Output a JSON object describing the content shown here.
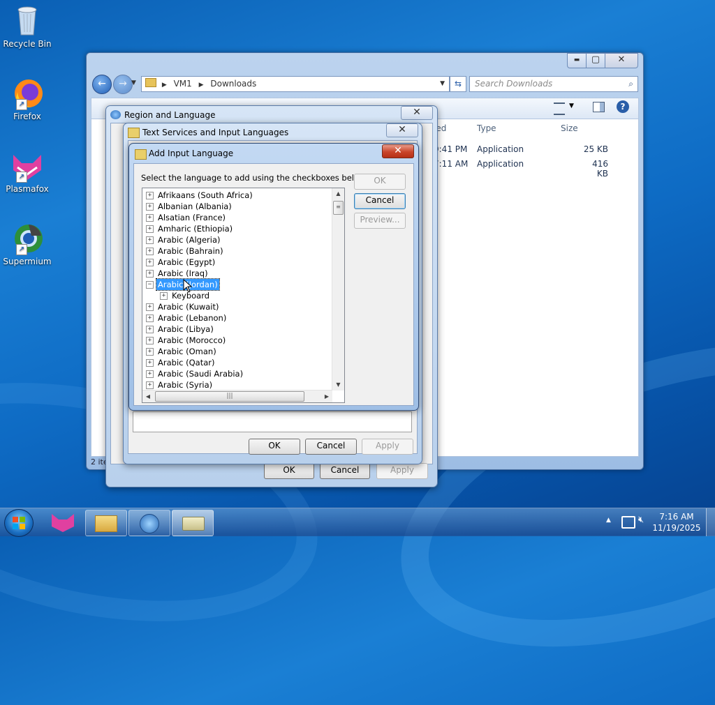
{
  "desktop": {
    "icons": [
      {
        "label": "Recycle Bin"
      },
      {
        "label": "Firefox"
      },
      {
        "label": "Plasmafox"
      },
      {
        "label": "Supermium"
      }
    ]
  },
  "explorer": {
    "caption_buttons": {
      "minimize": "▬",
      "maximize": "▢",
      "close": "✕"
    },
    "breadcrumb": [
      "VM1",
      "Downloads"
    ],
    "search_placeholder": "Search Downloads",
    "columns": [
      "ied",
      "Type",
      "Size"
    ],
    "files": [
      {
        "modified": "9:41 PM",
        "type": "Application",
        "size": "25 KB"
      },
      {
        "modified": "7:11 AM",
        "type": "Application",
        "size": "416 KB"
      }
    ],
    "status": "2 ite"
  },
  "region_dialog": {
    "title": "Region and Language",
    "buttons": {
      "ok": "OK",
      "cancel": "Cancel",
      "apply": "Apply"
    }
  },
  "text_services_dialog": {
    "title": "Text Services and Input Languages",
    "buttons": {
      "ok": "OK",
      "cancel": "Cancel",
      "apply": "Apply"
    }
  },
  "add_language_dialog": {
    "title": "Add Input Language",
    "instruction": "Select the language to add using the checkboxes below.",
    "buttons": {
      "ok": "OK",
      "cancel": "Cancel",
      "preview": "Preview..."
    },
    "languages": [
      {
        "label": "Afrikaans (South Africa)",
        "expanded": false
      },
      {
        "label": "Albanian (Albania)",
        "expanded": false
      },
      {
        "label": "Alsatian (France)",
        "expanded": false
      },
      {
        "label": "Amharic (Ethiopia)",
        "expanded": false
      },
      {
        "label": "Arabic (Algeria)",
        "expanded": false
      },
      {
        "label": "Arabic (Bahrain)",
        "expanded": false
      },
      {
        "label": "Arabic (Egypt)",
        "expanded": false
      },
      {
        "label": "Arabic (Iraq)",
        "expanded": false
      },
      {
        "label": "Arabic (Jordan)",
        "expanded": true,
        "selected": true
      },
      {
        "label": "Keyboard",
        "child": true
      },
      {
        "label": "Arabic (Kuwait)",
        "expanded": false
      },
      {
        "label": "Arabic (Lebanon)",
        "expanded": false
      },
      {
        "label": "Arabic (Libya)",
        "expanded": false
      },
      {
        "label": "Arabic (Morocco)",
        "expanded": false
      },
      {
        "label": "Arabic (Oman)",
        "expanded": false
      },
      {
        "label": "Arabic (Qatar)",
        "expanded": false
      },
      {
        "label": "Arabic (Saudi Arabia)",
        "expanded": false
      },
      {
        "label": "Arabic (Syria)",
        "expanded": false
      }
    ],
    "hscroll_grip": "|||"
  },
  "taskbar": {
    "clock_time": "7:16 AM",
    "clock_date": "11/19/2025"
  }
}
